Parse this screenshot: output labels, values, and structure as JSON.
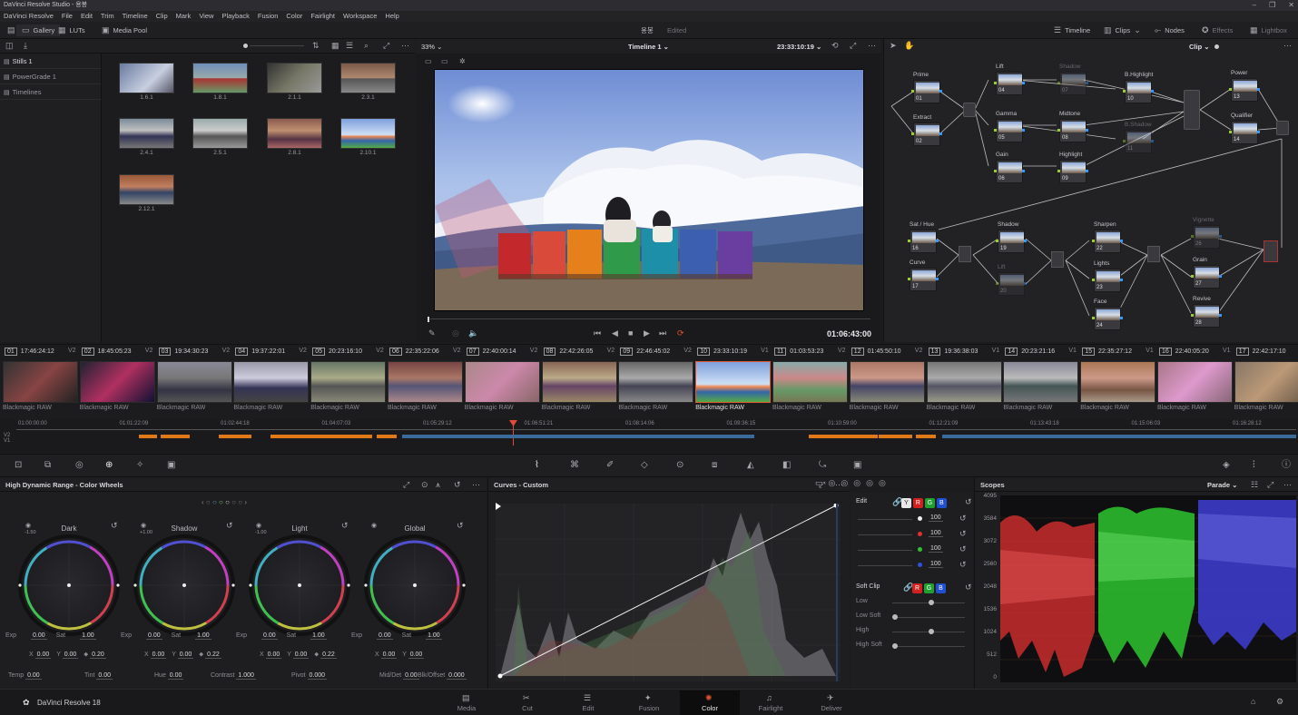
{
  "window": {
    "title": "DaVinci Resolve Studio - 용봉"
  },
  "menu": [
    "DaVinci Resolve",
    "File",
    "Edit",
    "Trim",
    "Timeline",
    "Clip",
    "Mark",
    "View",
    "Playback",
    "Fusion",
    "Color",
    "Fairlight",
    "Workspace",
    "Help"
  ],
  "toolbar": {
    "gallery": "Gallery",
    "luts": "LUTs",
    "media_pool": "Media Pool",
    "project": "용봉",
    "edited": "Edited",
    "timeline": "Timeline",
    "clips": "Clips",
    "nodes": "Nodes",
    "effects": "Effects",
    "lightbox": "Lightbox"
  },
  "gallery": {
    "albums": [
      "Stills 1",
      "PowerGrade 1",
      "Timelines"
    ],
    "stills": [
      "1.6.1",
      "1.8.1",
      "2.1.1",
      "2.3.1",
      "2.4.1",
      "2.5.1",
      "2.8.1",
      "2.10.1",
      "2.12.1"
    ]
  },
  "viewer": {
    "zoom": "33%",
    "timeline_name": "Timeline 1",
    "timecode": "23:33:10:19",
    "playhead_tc": "01:06:43:00"
  },
  "nodes_panel": {
    "mode": "Clip",
    "nodes": [
      {
        "label": "Prime",
        "num": "01"
      },
      {
        "label": "Extract",
        "num": "02"
      },
      {
        "label": "Lift",
        "num": "04"
      },
      {
        "label": "Shadow",
        "num": "07"
      },
      {
        "label": "B.Highlight",
        "num": "10"
      },
      {
        "label": "Power",
        "num": "13"
      },
      {
        "label": "Gamma",
        "num": "05"
      },
      {
        "label": "Midtone",
        "num": "08"
      },
      {
        "label": "B.Shadow",
        "num": "11"
      },
      {
        "label": "Qualifier",
        "num": "14"
      },
      {
        "label": "Gain",
        "num": "06"
      },
      {
        "label": "Highlight",
        "num": "09"
      },
      {
        "label": "Sat / Hue",
        "num": "16"
      },
      {
        "label": "Shadow",
        "num": "19"
      },
      {
        "label": "Sharpen",
        "num": "22"
      },
      {
        "label": "Vignette",
        "num": "26"
      },
      {
        "label": "Curve",
        "num": "17"
      },
      {
        "label": "Lift",
        "num": "20"
      },
      {
        "label": "Lights",
        "num": "23"
      },
      {
        "label": "Grain",
        "num": "27"
      },
      {
        "label": "Face",
        "num": "24"
      },
      {
        "label": "Revive",
        "num": "28"
      }
    ]
  },
  "clips": [
    {
      "num": "01",
      "tc": "17:46:24:12",
      "track": "V2",
      "codec": "Blackmagic RAW"
    },
    {
      "num": "02",
      "tc": "18:45:05:23",
      "track": "V2",
      "codec": "Blackmagic RAW"
    },
    {
      "num": "03",
      "tc": "19:34:30:23",
      "track": "V2",
      "codec": "Blackmagic RAW"
    },
    {
      "num": "04",
      "tc": "19:37:22:01",
      "track": "V2",
      "codec": "Blackmagic RAW"
    },
    {
      "num": "05",
      "tc": "20:23:16:10",
      "track": "V2",
      "codec": "Blackmagic RAW"
    },
    {
      "num": "06",
      "tc": "22:35:22:06",
      "track": "V2",
      "codec": "Blackmagic RAW"
    },
    {
      "num": "07",
      "tc": "22:40:00:14",
      "track": "V2",
      "codec": "Blackmagic RAW"
    },
    {
      "num": "08",
      "tc": "22:42:26:05",
      "track": "V2",
      "codec": "Blackmagic RAW"
    },
    {
      "num": "09",
      "tc": "22:46:45:02",
      "track": "V2",
      "codec": "Blackmagic RAW"
    },
    {
      "num": "10",
      "tc": "23:33:10:19",
      "track": "V1",
      "codec": "Blackmagic RAW"
    },
    {
      "num": "11",
      "tc": "01:03:53:23",
      "track": "V2",
      "codec": "Blackmagic RAW"
    },
    {
      "num": "12",
      "tc": "01:45:50:10",
      "track": "V2",
      "codec": "Blackmagic RAW"
    },
    {
      "num": "13",
      "tc": "19:36:38:03",
      "track": "V1",
      "codec": "Blackmagic RAW"
    },
    {
      "num": "14",
      "tc": "20:23:21:16",
      "track": "V1",
      "codec": "Blackmagic RAW"
    },
    {
      "num": "15",
      "tc": "22:35:27:12",
      "track": "V1",
      "codec": "Blackmagic RAW"
    },
    {
      "num": "16",
      "tc": "22:40:05:20",
      "track": "V1",
      "codec": "Blackmagic RAW"
    },
    {
      "num": "17",
      "tc": "22:42:17:10",
      "track": "",
      "codec": "Blackmagic RAW"
    }
  ],
  "timeline_ruler": [
    "01:00:00:00",
    "01:01:22:09",
    "01:02:44:18",
    "01:04:07:03",
    "01:05:29:12",
    "01:06:51:21",
    "01:08:14:06",
    "01:09:36:15",
    "01:10:59:00",
    "01:12:21:09",
    "01:13:43:18",
    "01:15:06:03",
    "01:16:28:12"
  ],
  "tracks": [
    "V2",
    "V1"
  ],
  "wheels": {
    "title": "High Dynamic Range - Color Wheels",
    "zones": [
      {
        "name": "Dark",
        "ev": "-1.50",
        "exp": "0.00",
        "sat": "1.00",
        "x": "0.00",
        "y": "0.00",
        "z": "0.20"
      },
      {
        "name": "Shadow",
        "ev": "+1.00",
        "exp": "0.00",
        "sat": "1.00",
        "x": "0.00",
        "y": "0.00",
        "z": "0.22"
      },
      {
        "name": "Light",
        "ev": "-1.00",
        "exp": "0.00",
        "sat": "1.00",
        "x": "0.00",
        "y": "0.00",
        "z": "0.22"
      },
      {
        "name": "Global",
        "ev": "",
        "exp": "0.00",
        "sat": "1.00",
        "x": "0.00",
        "y": "0.00",
        "z": ""
      }
    ],
    "labels": {
      "exp": "Exp",
      "sat": "Sat",
      "x": "X",
      "y": "Y"
    },
    "bottom": [
      {
        "label": "Temp",
        "value": "0.00"
      },
      {
        "label": "Tint",
        "value": "0.00"
      },
      {
        "label": "Hue",
        "value": "0.00"
      },
      {
        "label": "Contrast",
        "value": "1.000"
      },
      {
        "label": "Pivot",
        "value": "0.000"
      },
      {
        "label": "Mid/Det",
        "value": "0.00"
      },
      {
        "label": "Blk/Offset",
        "value": "0.000"
      }
    ]
  },
  "curves": {
    "title": "Curves - Custom"
  },
  "edit_panel": {
    "edit_label": "Edit",
    "channels": [
      "Y",
      "R",
      "G",
      "B"
    ],
    "values": [
      "100",
      "100",
      "100",
      "100"
    ],
    "soft_clip_label": "Soft Clip",
    "soft_rows": [
      "Low",
      "Low Soft",
      "High",
      "High Soft"
    ]
  },
  "scopes": {
    "title": "Scopes",
    "mode": "Parade",
    "scale": [
      "4095",
      "3584",
      "3072",
      "2560",
      "2048",
      "1536",
      "1024",
      "512",
      "0"
    ]
  },
  "bottom_bar": {
    "app": "DaVinci Resolve 18",
    "pages": [
      "Media",
      "Cut",
      "Edit",
      "Fusion",
      "Color",
      "Fairlight",
      "Deliver"
    ],
    "active": "Color"
  }
}
